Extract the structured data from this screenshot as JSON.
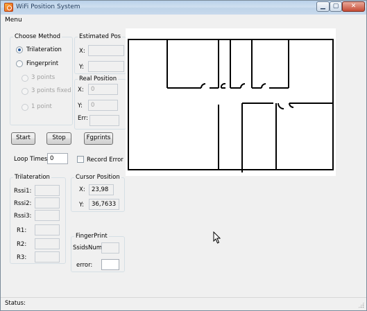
{
  "window": {
    "title": "WiFi Position System",
    "caption_min": "▁",
    "caption_max": "▢",
    "caption_close": "✕"
  },
  "menu": {
    "label": "Menu"
  },
  "method": {
    "title": "Choose Method",
    "trilateration": "Trilateration",
    "fingerprint": "Fingerprint",
    "points3": "3 points",
    "points3fixed": "3 points fixed",
    "point1": "1 point",
    "selected": "Trilateration"
  },
  "estimated": {
    "title": "Estimated Pos",
    "x_label": "X:",
    "y_label": "Y:",
    "x_value": "",
    "y_value": ""
  },
  "real": {
    "title": "Real Position",
    "x_label": "X:",
    "y_label": "Y:",
    "err_label": "Err:",
    "x_value": "0",
    "y_value": "0",
    "err_value": ""
  },
  "buttons": {
    "start": "Start",
    "stop": "Stop",
    "fgprints": "Fgprints"
  },
  "loop": {
    "label": "Loop Times:",
    "value": "0"
  },
  "record_error": {
    "label": "Record Error",
    "checked": false
  },
  "trilateration": {
    "title": "Trilateration",
    "rssi1": "Rssi1:",
    "rssi2": "Rssi2:",
    "rssi3": "Rssi3:",
    "r1": "R1:",
    "r2": "R2:",
    "r3": "R3:",
    "rssi1_value": "",
    "rssi2_value": "",
    "rssi3_value": "",
    "r1_value": "",
    "r2_value": "",
    "r3_value": ""
  },
  "cursor_position": {
    "title": "Cursor Position",
    "x_label": "X:",
    "y_label": "Y:",
    "x_value": "23,98",
    "y_value": "36,7633"
  },
  "fingerprint": {
    "title": "FingerPrint",
    "ssids_label": "SsidsNum:",
    "error_label": "error:",
    "ssids_value": "",
    "error_value": ""
  },
  "status": {
    "label": "Status:"
  },
  "colors": {
    "title_text": "#1e395b",
    "wall": "#000000",
    "window_bg": "#f0f0f0"
  }
}
